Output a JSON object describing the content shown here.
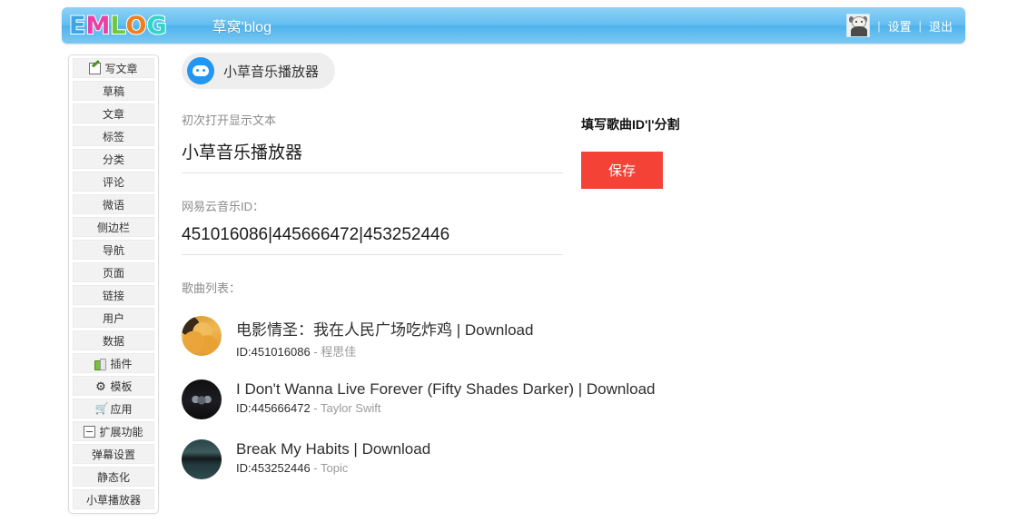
{
  "topbar": {
    "logo_letters": [
      "E",
      "M",
      "L",
      "O",
      "G"
    ],
    "blog_title": "草窝'blog",
    "avatar_name": "user-avatar",
    "separator": "|",
    "settings_label": "设置",
    "logout_label": "退出"
  },
  "sidebar": {
    "items": [
      {
        "label": "写文章",
        "icon": "write-icon"
      },
      {
        "label": "草稿",
        "icon": null
      },
      {
        "label": "文章",
        "icon": null
      },
      {
        "label": "标签",
        "icon": null
      },
      {
        "label": "分类",
        "icon": null
      },
      {
        "label": "评论",
        "icon": null
      },
      {
        "label": "微语",
        "icon": null
      },
      {
        "label": "侧边栏",
        "icon": null
      },
      {
        "label": "导航",
        "icon": null
      },
      {
        "label": "页面",
        "icon": null
      },
      {
        "label": "链接",
        "icon": null
      },
      {
        "label": "用户",
        "icon": null
      },
      {
        "label": "数据",
        "icon": null
      },
      {
        "label": "插件",
        "icon": "plugin-icon"
      },
      {
        "label": "模板",
        "icon": "gear-icon"
      },
      {
        "label": "应用",
        "icon": "cart-icon"
      },
      {
        "label": "扩展功能",
        "icon": "minus-box-icon"
      },
      {
        "label": "弹幕设置",
        "icon": null
      },
      {
        "label": "静态化",
        "icon": null
      },
      {
        "label": "小草播放器",
        "icon": null
      }
    ]
  },
  "main": {
    "tab": {
      "icon": "player-face-icon",
      "label": "小草音乐播放器"
    },
    "fields": [
      {
        "label": "初次打开显示文本",
        "value": "小草音乐播放器"
      },
      {
        "label": "网易云音乐ID：",
        "value": "451016086|445666472|453252446"
      }
    ],
    "hint": "填写歌曲ID'|'分割",
    "save_label": "保存",
    "list_label": "歌曲列表：",
    "songs": [
      {
        "thumb": "thumb-chicken",
        "title": "电影情圣：我在人民广场吃炸鸡 | Download",
        "id": "ID:451016086",
        "dash": " - ",
        "artist": "程思佳"
      },
      {
        "thumb": "thumb-mask",
        "title": "I Don't Wanna Live Forever (Fifty Shades Darker) | Download",
        "id": "ID:445666472",
        "dash": " - ",
        "artist": "Taylor Swift"
      },
      {
        "thumb": "thumb-lake",
        "title": "Break My Habits | Download",
        "id": "ID:453252446",
        "dash": " - ",
        "artist": "Topic"
      }
    ]
  },
  "colors": {
    "header_blue": "#63bdf0",
    "accent_red": "#f44336",
    "tab_blue": "#2196f3",
    "muted_text": "#8b8b8b"
  }
}
